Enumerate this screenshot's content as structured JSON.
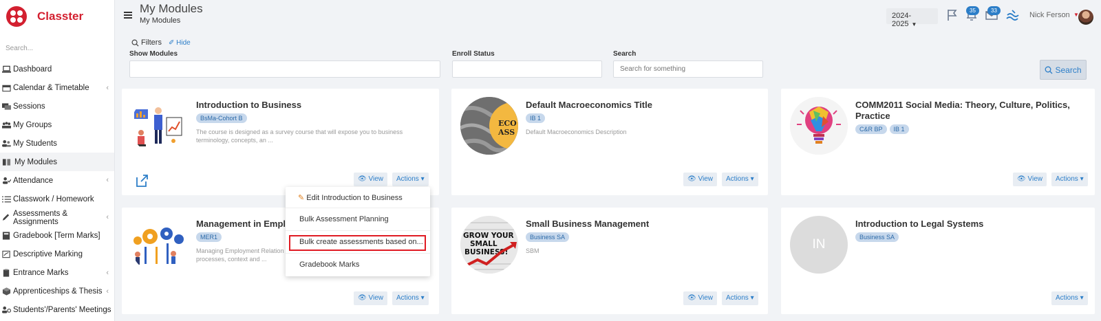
{
  "app": {
    "brand": "Classter"
  },
  "sidebar": {
    "search_placeholder": "Search...",
    "items": [
      {
        "label": "Dashboard",
        "icon": "laptop-icon",
        "arrow": false
      },
      {
        "label": "Calendar & Timetable",
        "icon": "calendar-icon",
        "arrow": true
      },
      {
        "label": "Sessions",
        "icon": "sessions-icon",
        "arrow": false
      },
      {
        "label": "My Groups",
        "icon": "groups-icon",
        "arrow": false
      },
      {
        "label": "My Students",
        "icon": "students-icon",
        "arrow": false
      },
      {
        "label": "My Modules",
        "icon": "book-icon",
        "arrow": false,
        "active": true
      },
      {
        "label": "Attendance",
        "icon": "attendance-icon",
        "arrow": true
      },
      {
        "label": "Classwork / Homework",
        "icon": "list-icon",
        "arrow": false
      },
      {
        "label": "Assessments & Assignments",
        "icon": "pencil-icon",
        "arrow": true
      },
      {
        "label": "Gradebook [Term Marks]",
        "icon": "gradebook-icon",
        "arrow": false
      },
      {
        "label": "Descriptive Marking",
        "icon": "marking-icon",
        "arrow": false
      },
      {
        "label": "Entrance Marks",
        "icon": "clipboard-icon",
        "arrow": true
      },
      {
        "label": "Apprenticeships & Thesis",
        "icon": "cube-icon",
        "arrow": true
      },
      {
        "label": "Students'/Parents' Meetings",
        "icon": "meeting-icon",
        "arrow": true
      }
    ]
  },
  "header": {
    "title": "My Modules",
    "breadcrumb": "My Modules",
    "year": "2024-2025",
    "notifications_count": "35",
    "messages_count": "33",
    "user_name": "Nick Ferson"
  },
  "filters": {
    "toggle_label": "Filters",
    "hide_label": "Hide",
    "show_modules_label": "Show Modules",
    "enroll_status_label": "Enroll Status",
    "search_label": "Search",
    "search_placeholder": "Search for something",
    "search_button": "Search"
  },
  "cards": [
    {
      "title": "Introduction to Business",
      "tags": [
        "BsMa-Cohort B"
      ],
      "desc": "The course is designed as a survey course that will expose you to business terminology, concepts, an ...",
      "view": "View",
      "actions": "Actions"
    },
    {
      "title": "Default Macroeconomics Title",
      "tags": [
        "IB 1"
      ],
      "desc": "Default Macroeconomics Description",
      "view": "View",
      "actions": "Actions"
    },
    {
      "title": "COMM2011 Social Media: Theory, Culture, Politics, Practice",
      "tags": [
        "C&R BP",
        "IB 1"
      ],
      "desc": "",
      "view": "View",
      "actions": "Actions"
    },
    {
      "title": "Management in Emplo",
      "tags": [
        "MER1"
      ],
      "desc": "Managing Employment Relation processes, context and ...",
      "view": "View",
      "actions": "Actions"
    },
    {
      "title": "Small Business Management",
      "tags": [
        "Business SA"
      ],
      "desc": "SBM",
      "view": "View",
      "actions": "Actions"
    },
    {
      "title": "Introduction to Legal Systems",
      "tags": [
        "Business SA"
      ],
      "desc": "",
      "initials": "IN",
      "actions": "Actions"
    }
  ],
  "dropdown": {
    "items": [
      "Edit Introduction to Business",
      "Bulk Assessment Planning",
      "Bulk create assessments based on...",
      "Gradebook Marks"
    ]
  },
  "images": {
    "macro_text": "ECO\nASS",
    "small_business_text": "GROW YOUR SMALL BUSINESS!"
  },
  "colors": {
    "brand": "#d32030",
    "accent": "#2c7ec8",
    "tag_bg": "#c7d8ec",
    "highlight": "#e01a22"
  }
}
